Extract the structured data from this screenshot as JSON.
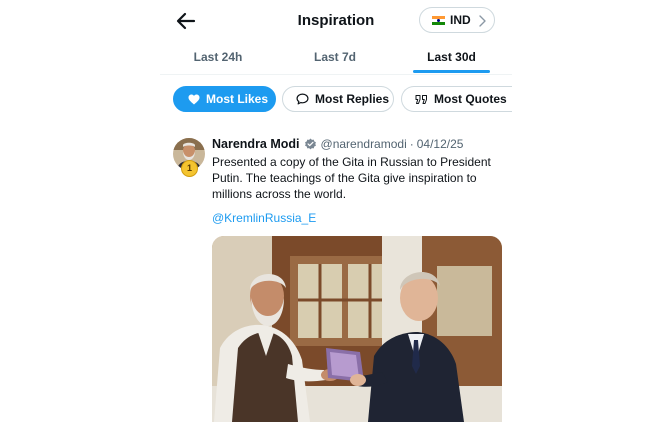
{
  "header": {
    "title": "Inspiration",
    "country": {
      "label": "IND",
      "flag": "india-flag"
    }
  },
  "tabs": [
    {
      "label": "Last 24h",
      "active": false
    },
    {
      "label": "Last 7d",
      "active": false
    },
    {
      "label": "Last 30d",
      "active": true
    }
  ],
  "filters": [
    {
      "label": "Most Likes",
      "icon": "heart-icon",
      "active": true
    },
    {
      "label": "Most Replies",
      "icon": "speech-bubble-icon",
      "active": false
    },
    {
      "label": "Most Quotes",
      "icon": "quote-icon",
      "active": false
    }
  ],
  "post": {
    "rank": "1",
    "author": "Narendra Modi",
    "verified": true,
    "handle": "@narendramodi",
    "separator": "·",
    "date": "04/12/25",
    "text": "Presented a copy of the Gita in Russian to President Putin. The teachings of the Gita give inspiration to millions across the world.",
    "mention": "@KremlinRussia_E",
    "media": "photo of two men in a room, one handing a book to the other"
  },
  "colors": {
    "accent": "#1d9bf0",
    "text": "#0f1419",
    "muted": "#536471",
    "border": "#cfd9de"
  }
}
